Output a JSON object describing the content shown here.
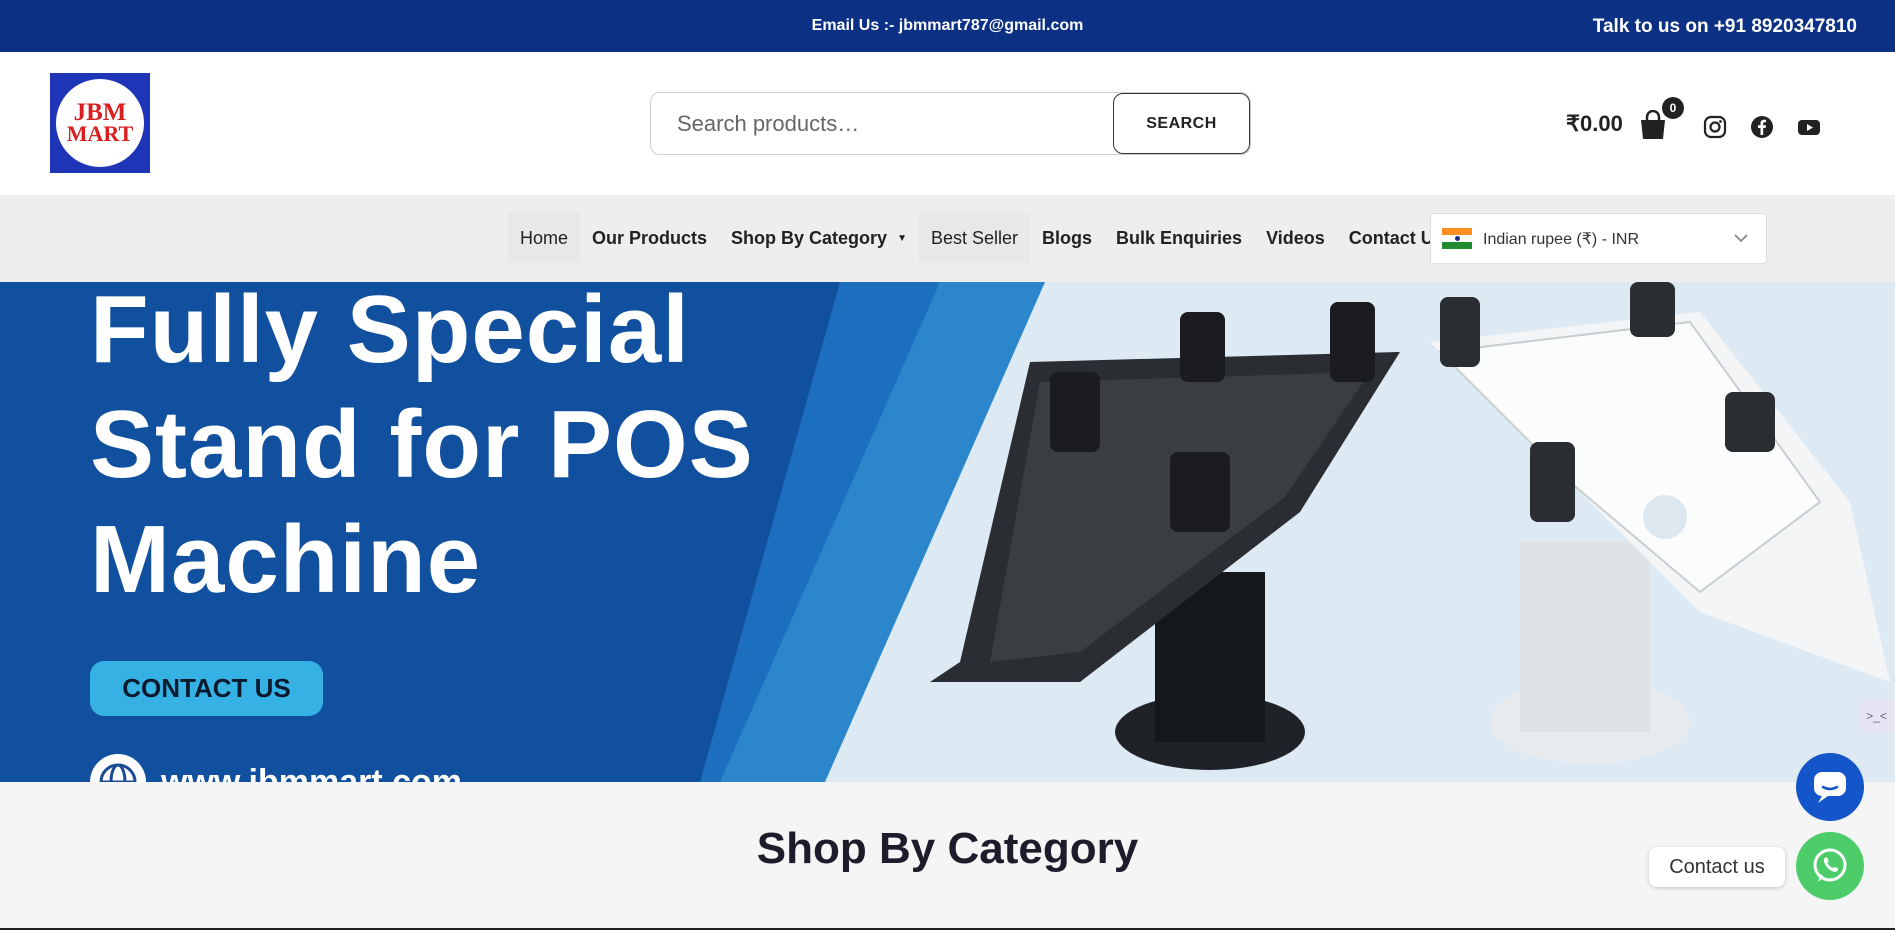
{
  "topbar": {
    "email": "Email Us :- jbmmart787@gmail.com",
    "phone": "Talk to us on +91 8920347810",
    "background": "#0c3184"
  },
  "logo": {
    "line1": "JBM",
    "line2": "MART"
  },
  "search": {
    "placeholder": "Search products…",
    "button_label": "SEARCH"
  },
  "cart": {
    "total": "₹0.00",
    "count": "0"
  },
  "social": [
    "instagram-icon",
    "facebook-icon",
    "youtube-icon"
  ],
  "nav": {
    "items": [
      {
        "label": "Home"
      },
      {
        "label": "Our Products"
      },
      {
        "label": "Shop By Category"
      },
      {
        "label": "Best Seller"
      },
      {
        "label": "Blogs"
      },
      {
        "label": "Bulk Enquiries"
      },
      {
        "label": "Videos"
      },
      {
        "label": "Contact Us"
      }
    ],
    "currency": "Indian rupee (₹) - INR"
  },
  "hero": {
    "line1": "Fully Special",
    "line2": "Stand for POS",
    "line3": "Machine",
    "cta": "CONTACT US",
    "website": "www.jbmmart.com",
    "accent": "#35b1e3"
  },
  "section": {
    "title": "Shop By Category"
  },
  "widgets": {
    "whatsapp_label": "Contact us",
    "side_tab": ">_<"
  }
}
